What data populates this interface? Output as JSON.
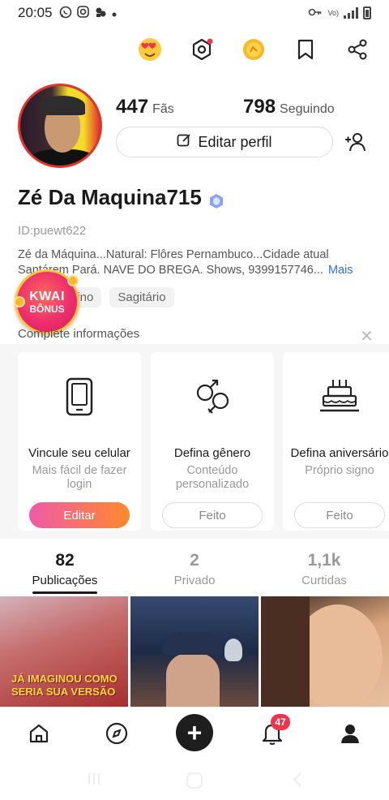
{
  "status_bar": {
    "time": "20:05",
    "icons": [
      "whatsapp-icon",
      "instagram-icon",
      "kwai-icon",
      "dot-icon"
    ],
    "right_icons": [
      "key-icon",
      "vowifi-icon",
      "signal-icon",
      "battery-icon"
    ],
    "vowifi": "Vo)"
  },
  "top_icons": [
    "love-emoji-icon",
    "settings-hex-icon",
    "coin-icon",
    "bookmark-icon",
    "share-icon"
  ],
  "profile": {
    "followers_count": "447",
    "followers_label": "Fãs",
    "following_count": "798",
    "following_label": "Seguindo",
    "edit_profile_label": "Editar perfil",
    "username": "Zé Da Maquina715",
    "user_id": "ID:puewt622",
    "bio": "Zé da Máquina...Natural: Flôres Pernambuco...Cidade  atual Santárem Pará. NAVE DO BREGA. Shows, 9399157746...",
    "bio_more": "Mais",
    "tags": [
      "lino",
      "Sagitário"
    ]
  },
  "kwai_bonus": {
    "line1": "KWAI",
    "line2": "BÔNUS"
  },
  "complete_info": {
    "header": "Complete informações",
    "close": "✕",
    "cards": [
      {
        "title": "Vincule seu celular",
        "subtitle": "Mais fácil de fazer  login",
        "button": "Editar",
        "icon": "phone-icon"
      },
      {
        "title": "Defina gênero",
        "subtitle": "Conteúdo personalizado",
        "button": "Feito",
        "icon": "gender-icon"
      },
      {
        "title": "Defina aniversário",
        "subtitle": "Próprio signo",
        "button": "Feito",
        "icon": "cake-icon"
      }
    ]
  },
  "tabs": [
    {
      "count": "82",
      "label": "Publicações",
      "active": true
    },
    {
      "count": "2",
      "label": "Privado",
      "active": false
    },
    {
      "count": "1,1k",
      "label": "Curtidas",
      "active": false
    }
  ],
  "thumbnails": [
    {
      "caption": "JÁ IMAGINOU COMO SERIA SUA VERSÃO"
    },
    {
      "caption": ""
    },
    {
      "caption": ""
    }
  ],
  "bottom_nav": {
    "items": [
      "home-icon",
      "discover-icon",
      "create-icon",
      "notifications-icon",
      "profile-icon"
    ],
    "notification_count": "47",
    "plus": "+"
  },
  "colors": {
    "accent_pink": "#f05aa8",
    "accent_orange": "#ff8a2a",
    "badge_red": "#f0344c",
    "link_blue": "#2f6fdc"
  }
}
